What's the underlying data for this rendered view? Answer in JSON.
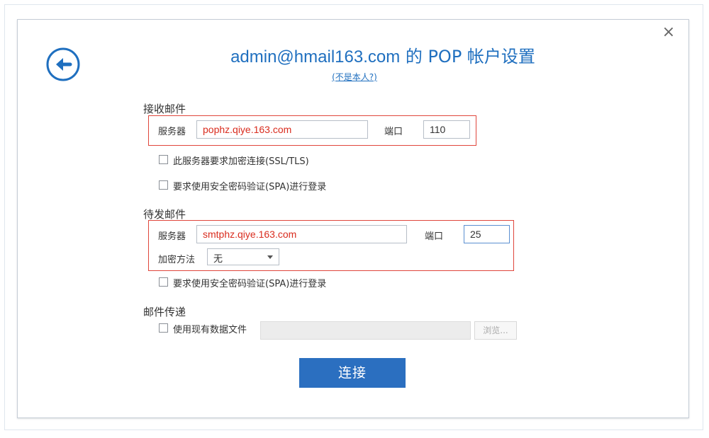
{
  "dialog": {
    "close_glyph": "×",
    "title_email": "admin@hmail163.com",
    "title_rest": " 的 POP 帐户设置",
    "not_me": "(不是本人?)"
  },
  "incoming": {
    "section": "接收邮件",
    "server_label": "服务器",
    "server_value": "pophz.qiye.163.com",
    "port_label": "端口",
    "port_value": "110",
    "ssl_label": "此服务器要求加密连接(SSL/TLS)",
    "spa_label": "要求使用安全密码验证(SPA)进行登录"
  },
  "outgoing": {
    "section": "待发邮件",
    "server_label": "服务器",
    "server_value": "smtphz.qiye.163.com",
    "port_label": "端口",
    "port_value": "25",
    "encryption_label": "加密方法",
    "encryption_value": "无",
    "spa_label": "要求使用安全密码验证(SPA)进行登录"
  },
  "delivery": {
    "section": "邮件传递",
    "existing_file_label": "使用现有数据文件",
    "browse_label": "浏览..."
  },
  "connect_label": "连接",
  "colors": {
    "accent": "#1f6fbf",
    "button": "#2b6fc0",
    "highlight_red": "#e0463c"
  },
  "icons": {
    "back": "back-arrow-circle-icon",
    "close": "close-icon",
    "dropdown": "chevron-down-icon"
  }
}
